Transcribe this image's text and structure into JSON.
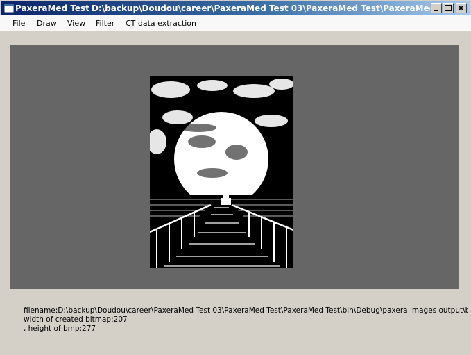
{
  "window": {
    "app_title": "PaxeraMed Test",
    "document_path": "D:\\backup\\Doudou\\career\\PaxeraMed Test 03\\PaxeraMed Test\\PaxeraMed Test\\bin\\Debug\\paxera images output\\big_moon",
    "controls": {
      "minimize_icon": "minimize-icon",
      "maximize_icon": "maximize-icon",
      "close_icon": "close-icon"
    }
  },
  "menu": {
    "file": "File",
    "draw": "Draw",
    "view": "View",
    "filter": "Filter",
    "ct": "CT data extraction"
  },
  "output": {
    "filename_line": "filename:D:\\backup\\Doudou\\career\\PaxeraMed Test 03\\PaxeraMed Test\\PaxeraMed Test\\bin\\Debug\\paxera images output\\big_moon",
    "width_line": "width of created bitmap:207",
    "height_line": ", height of bmp:277"
  },
  "colors": {
    "canvas": "#666666",
    "window_face": "#d4d0c8",
    "title_active": "#0a246a"
  }
}
